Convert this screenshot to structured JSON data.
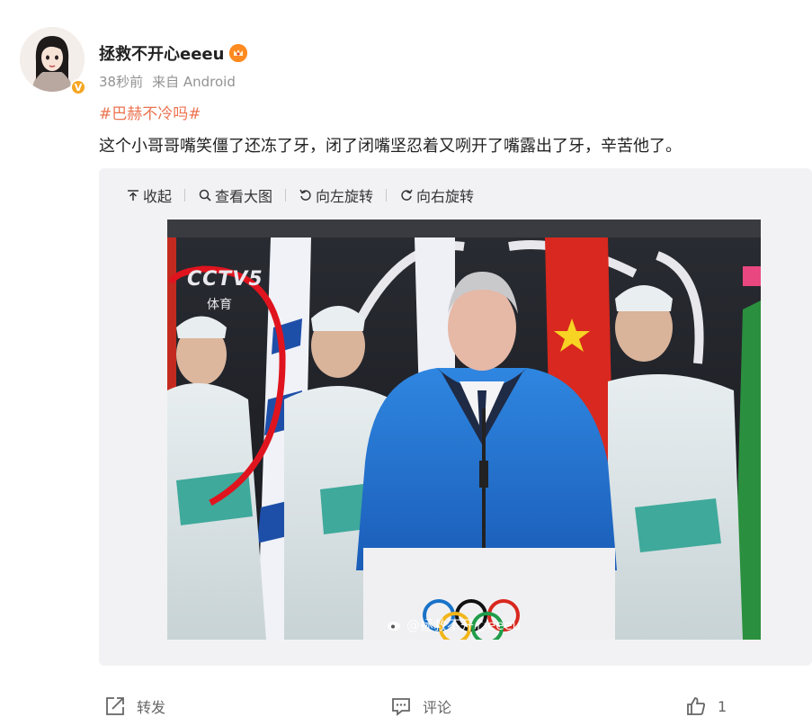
{
  "user": {
    "name": "拯救不开心eeeu",
    "verified": true,
    "avatar_icon": "avatar-illustration",
    "badge_icon": "crown-icon"
  },
  "meta": {
    "time": "38秒前",
    "source": "来自 Android"
  },
  "post": {
    "hashtag": "#巴赫不冷吗#",
    "text": "这个小哥哥嘴笑僵了还冻了牙，闭了闭嘴坚忍着又咧开了嘴露出了牙，辛苦他了。"
  },
  "toolbar": {
    "collapse": "收起",
    "view_large": "查看大图",
    "rotate_left": "向左旋转",
    "rotate_right": "向右旋转"
  },
  "photo": {
    "broadcaster_logo": "CCTV5",
    "channel_label": "体育",
    "watermark": "@拯救不开心eeeu"
  },
  "actions": {
    "repost": "转发",
    "comment": "评论",
    "like_count": "1"
  },
  "colors": {
    "link": "#eb7350",
    "panel_bg": "#f2f2f5",
    "badge": "#f5a623"
  }
}
